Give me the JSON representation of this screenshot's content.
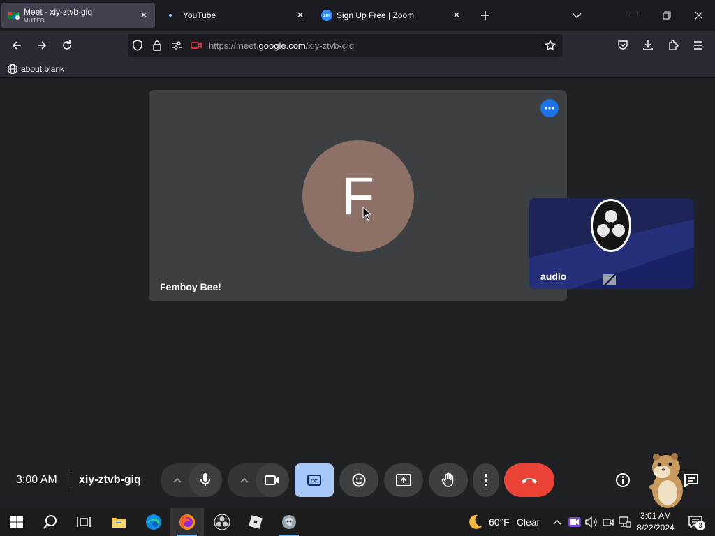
{
  "browser": {
    "tabs": [
      {
        "title": "Meet - xiy-ztvb-giq",
        "subtitle": "MUTED",
        "active": true
      },
      {
        "title": "YouTube",
        "active": false
      },
      {
        "title": "Sign Up Free | Zoom",
        "favicon_text": "zm",
        "active": false
      }
    ],
    "url_prefix": "https://meet.",
    "url_host": "google.com",
    "url_path": "/xiy-ztvb-giq",
    "bookmark_label": "about:blank"
  },
  "meet": {
    "main_tile": {
      "avatar_letter": "F",
      "name": "Femboy Bee!"
    },
    "self_tile": {
      "name": "audio"
    },
    "time": "3:00 AM",
    "meeting_code": "xiy-ztvb-giq",
    "colors": {
      "end_call": "#ea4335",
      "captions_active": "#a8c7fa",
      "tile_bg": "#3c4043",
      "avatar_bg": "#8d7166"
    }
  },
  "taskbar": {
    "weather_temp": "60°F",
    "weather_cond": "Clear",
    "clock_time": "3:01 AM",
    "clock_date": "8/22/2024",
    "notif_count": "3"
  }
}
